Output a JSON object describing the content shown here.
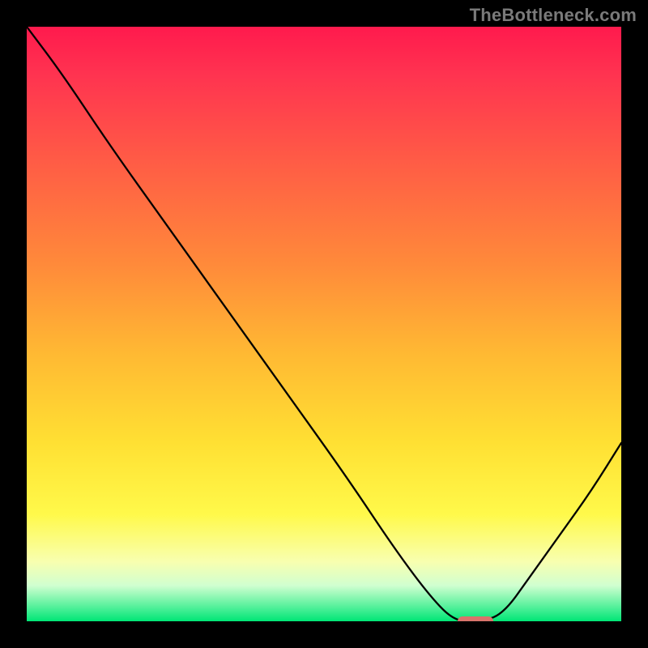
{
  "watermark": {
    "text": "TheBottleneck.com"
  },
  "chart_data": {
    "type": "line",
    "title": "",
    "xlabel": "",
    "ylabel": "",
    "xlim": [
      0,
      100
    ],
    "ylim": [
      0,
      100
    ],
    "grid": false,
    "legend": false,
    "series": [
      {
        "name": "bottleneck-curve",
        "x": [
          0,
          6,
          14,
          24,
          34,
          44,
          54,
          62,
          68,
          72,
          76,
          80,
          85,
          90,
          95,
          100
        ],
        "y": [
          100,
          92,
          80,
          66,
          52,
          38,
          24,
          12,
          4,
          0,
          0,
          1,
          8,
          15,
          22,
          30
        ]
      }
    ],
    "marker": {
      "name": "optimal-point",
      "x_range": [
        72.5,
        78.5
      ],
      "y": 0,
      "color": "#d9736b"
    },
    "gradient_stops": [
      {
        "pos": 0,
        "color": "#ff1a4d"
      },
      {
        "pos": 22,
        "color": "#ff5a46"
      },
      {
        "pos": 55,
        "color": "#ffb933"
      },
      {
        "pos": 82,
        "color": "#fff94a"
      },
      {
        "pos": 100,
        "color": "#00e676"
      }
    ]
  }
}
